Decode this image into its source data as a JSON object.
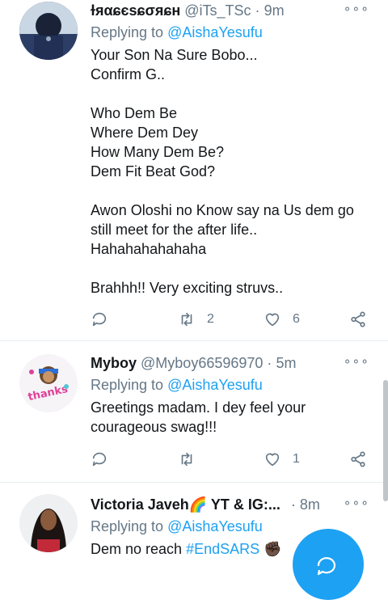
{
  "tweets": [
    {
      "name": "ɫяαɕєѕɕσяɕн",
      "handle": "@iTs_TSc",
      "dot": "·",
      "time": "9m",
      "replying_prefix": "Replying to",
      "replying_to": "@AishaYesufu",
      "lines": [
        "Your Son Na Sure Bobo...",
        "Confirm G..",
        "",
        "Who Dem Be",
        "Where Dem Dey",
        "How Many Dem Be?",
        "Dem Fit Beat God?",
        "",
        "Awon Oloshi no Know say na Us dem go still meet for the after life..",
        "Hahahahahahaha",
        "",
        "Brahhh!! Very exciting struvs.."
      ],
      "retweets": "2",
      "likes": "6"
    },
    {
      "name": "Myboy",
      "handle": "@Myboy66596970",
      "dot": "·",
      "time": "5m",
      "replying_prefix": "Replying to",
      "replying_to": "@AishaYesufu",
      "lines": [
        "Greetings madam. I dey feel your courageous swag!!!"
      ],
      "retweets": "",
      "likes": "1",
      "avatar_text": "thanks"
    },
    {
      "name": "Victoria Javeh🌈 YT & IG:...",
      "handle": "",
      "dot": "·",
      "time": "8m",
      "replying_prefix": "Replying to",
      "replying_to": "@AishaYesufu",
      "text_prefix": "Dem no reach",
      "hashtag": "#EndSARS",
      "emoji": "✊🏿"
    }
  ],
  "colors": {
    "accent": "#1da1f2",
    "secondary": "#657786",
    "divider": "#e6ecf0"
  }
}
